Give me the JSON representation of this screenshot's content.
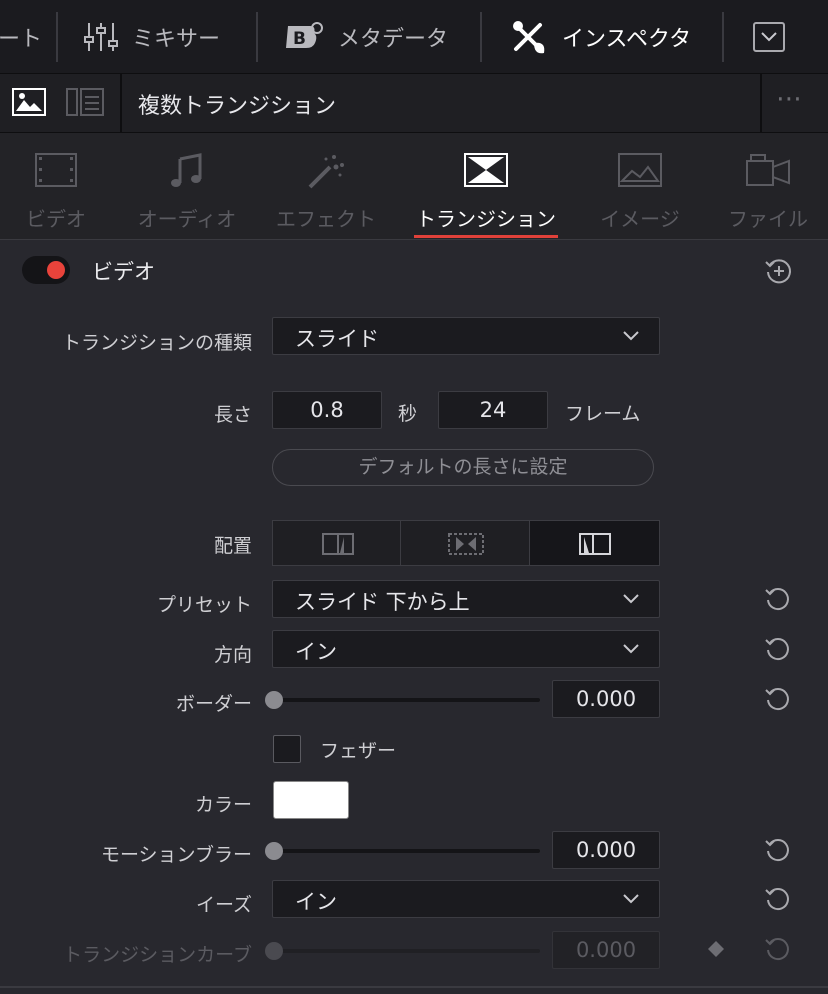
{
  "toolbar": {
    "partial_label": "ート",
    "mixer_label": "ミキサー",
    "metadata_label": "メタデータ",
    "inspector_label": "インスペクタ"
  },
  "header": {
    "title": "複数トランジション",
    "more_icon": "⋯"
  },
  "tabs": [
    {
      "label": "ビデオ",
      "icon": "film-icon",
      "active": false
    },
    {
      "label": "オーディオ",
      "icon": "music-note-icon",
      "active": false
    },
    {
      "label": "エフェクト",
      "icon": "magic-wand-icon",
      "active": false
    },
    {
      "label": "トランジション",
      "icon": "transition-icon",
      "active": true
    },
    {
      "label": "イメージ",
      "icon": "image-icon",
      "active": false
    },
    {
      "label": "ファイル",
      "icon": "camera-icon",
      "active": false
    }
  ],
  "section": {
    "title": "ビデオ",
    "enabled": true,
    "accent_color": "#e8433b"
  },
  "fields": {
    "transition_type_label": "トランジションの種類",
    "transition_type_value": "スライド",
    "duration_label": "長さ",
    "duration_seconds": "0.8",
    "seconds_unit": "秒",
    "duration_frames": "24",
    "frames_unit": "フレーム",
    "default_button": "デフォルトの長さに設定",
    "alignment_label": "配置",
    "alignment_selected": "end",
    "preset_label": "プリセット",
    "preset_value": "スライド 下から上",
    "direction_label": "方向",
    "direction_value": "イン",
    "border_label": "ボーダー",
    "border_value": "0.000",
    "feather_label": "フェザー",
    "feather_checked": false,
    "color_label": "カラー",
    "color_value": "#ffffff",
    "motion_blur_label": "モーションブラー",
    "motion_blur_value": "0.000",
    "ease_label": "イーズ",
    "ease_value": "イン",
    "curve_label": "トランジションカーブ",
    "curve_value": "0.000"
  }
}
